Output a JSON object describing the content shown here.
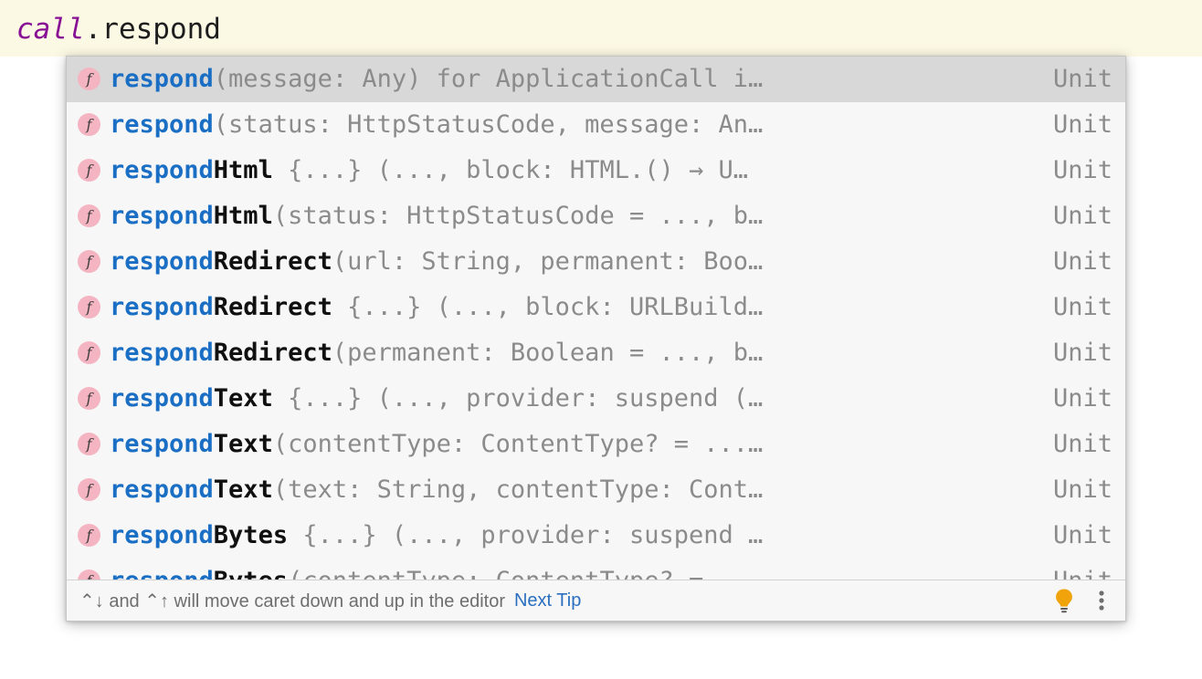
{
  "editor": {
    "receiver": "call",
    "member": ".respond"
  },
  "popup": {
    "selected_index": 0,
    "rows": [
      {
        "match": "respond",
        "rest": "",
        "tail": "(message: Any) for ApplicationCall i…",
        "type": "Unit"
      },
      {
        "match": "respond",
        "rest": "",
        "tail": "(status: HttpStatusCode, message: An…",
        "type": "Unit"
      },
      {
        "match": "respond",
        "rest": "Html",
        "tail": " {...} (..., block: HTML.() → U…",
        "type": "Unit"
      },
      {
        "match": "respond",
        "rest": "Html",
        "tail": "(status: HttpStatusCode = ..., b…",
        "type": "Unit"
      },
      {
        "match": "respond",
        "rest": "Redirect",
        "tail": "(url: String, permanent: Boo…",
        "type": "Unit"
      },
      {
        "match": "respond",
        "rest": "Redirect",
        "tail": " {...} (..., block: URLBuild…",
        "type": "Unit"
      },
      {
        "match": "respond",
        "rest": "Redirect",
        "tail": "(permanent: Boolean = ..., b…",
        "type": "Unit"
      },
      {
        "match": "respond",
        "rest": "Text",
        "tail": " {...} (..., provider: suspend (…",
        "type": "Unit"
      },
      {
        "match": "respond",
        "rest": "Text",
        "tail": "(contentType: ContentType? = ...…",
        "type": "Unit"
      },
      {
        "match": "respond",
        "rest": "Text",
        "tail": "(text: String, contentType: Cont…",
        "type": "Unit"
      },
      {
        "match": "respond",
        "rest": "Bytes",
        "tail": " {...} (..., provider: suspend …",
        "type": "Unit"
      },
      {
        "match": "respond",
        "rest": "Bytes",
        "tail": "(contentType: ContentType? = ",
        "type": "Unit"
      }
    ],
    "item_icon_glyph": "f"
  },
  "tip_bar": {
    "text": "⌃↓ and ⌃↑ will move caret down and up in the editor",
    "next_tip_label": "Next Tip"
  },
  "colors": {
    "editor_background": "#fbf8e3",
    "receiver_text": "#871094",
    "member_text": "#1d1d1d",
    "popup_background": "#f7f7f7",
    "selected_row_background": "#d8d8d8",
    "match_text": "#1a6fc4",
    "rest_text": "#101010",
    "signature_text": "#8b8b8b",
    "return_type_text": "#8b8b8b",
    "icon_circle": "#f5b4c2",
    "link": "#2a6fc0",
    "bulb": "#f0a30a",
    "tip_text": "#6e6e6e"
  }
}
